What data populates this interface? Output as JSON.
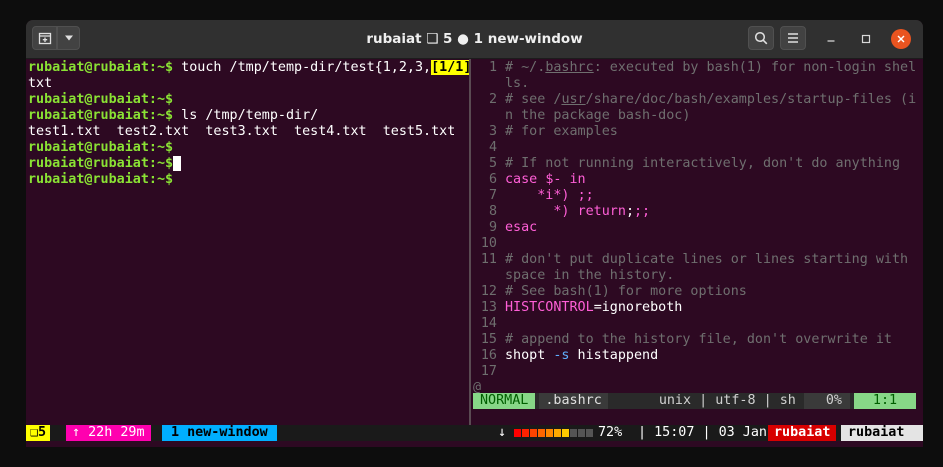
{
  "window": {
    "title": "rubaiat ❑ 5 ● 1 new-window",
    "buttons": [
      "new-tab-icon",
      "dropdown-icon",
      "search-icon",
      "menu-icon",
      "minimize-icon",
      "maximize-icon",
      "close-icon"
    ],
    "accent_close": "#e95420"
  },
  "terminal": {
    "lines": [
      {
        "prompt": "rubaiat@rubaiat:~$",
        "cmd": " touch /tmp/temp-dir/test{1,2,3,",
        "badge": "[1/1]"
      },
      {
        "text": "txt"
      },
      {
        "prompt": "rubaiat@rubaiat:~$",
        "cmd": ""
      },
      {
        "prompt": "rubaiat@rubaiat:~$",
        "cmd": " ls /tmp/temp-dir/"
      },
      {
        "text": "test1.txt  test2.txt  test3.txt  test4.txt  test5.txt"
      },
      {
        "prompt": "rubaiat@rubaiat:~$",
        "cmd": ""
      },
      {
        "prompt": "rubaiat@rubaiat:~$",
        "cmd": " ",
        "cursor": true
      },
      {
        "prompt": "rubaiat@rubaiat:~$",
        "cmd": ""
      }
    ],
    "prompt_color": "#8ae234",
    "badge_color": "#ffff00"
  },
  "vim": {
    "lines": [
      {
        "n": "1",
        "parts": [
          [
            "cm",
            "# ~/."
          ],
          [
            "cm ul",
            "bashrc"
          ],
          [
            "cm",
            ": executed by bash(1) for non-login shel"
          ]
        ]
      },
      {
        "n": "",
        "parts": [
          [
            "cm",
            "ls."
          ]
        ]
      },
      {
        "n": "2",
        "parts": [
          [
            "cm",
            "# see /"
          ],
          [
            "cm ul",
            "usr"
          ],
          [
            "cm",
            "/share/doc/bash/examples/startup-files (i"
          ]
        ]
      },
      {
        "n": "",
        "parts": [
          [
            "cm",
            "n the package bash-doc)"
          ]
        ]
      },
      {
        "n": "3",
        "parts": [
          [
            "cm",
            "# for examples"
          ]
        ]
      },
      {
        "n": "4",
        "parts": []
      },
      {
        "n": "5",
        "parts": [
          [
            "cm",
            "# If not running interactively, don't do anything"
          ]
        ]
      },
      {
        "n": "6",
        "parts": [
          [
            "kw",
            "case"
          ],
          [
            "vt",
            " "
          ],
          [
            "kw",
            "$-"
          ],
          [
            "vt",
            " "
          ],
          [
            "kw",
            "in"
          ]
        ]
      },
      {
        "n": "7",
        "parts": [
          [
            "vt",
            "    "
          ],
          [
            "kw",
            "*i*)"
          ],
          [
            "vt",
            " "
          ],
          [
            "kw",
            ";;"
          ]
        ]
      },
      {
        "n": "8",
        "parts": [
          [
            "vt",
            "      "
          ],
          [
            "kw",
            "*)"
          ],
          [
            "vt",
            " "
          ],
          [
            "kw",
            "return"
          ],
          [
            "vt",
            ";"
          ],
          [
            "kw",
            ";;"
          ]
        ]
      },
      {
        "n": "9",
        "parts": [
          [
            "kw",
            "esac"
          ]
        ]
      },
      {
        "n": "10",
        "parts": []
      },
      {
        "n": "11",
        "parts": [
          [
            "cm",
            "# don't put duplicate lines or lines starting with"
          ]
        ]
      },
      {
        "n": "",
        "parts": [
          [
            "cm",
            "space in the history."
          ]
        ]
      },
      {
        "n": "12",
        "parts": [
          [
            "cm",
            "# See bash(1) for more options"
          ]
        ]
      },
      {
        "n": "13",
        "parts": [
          [
            "kw",
            "HISTCONTROL"
          ],
          [
            "vt",
            "=ignoreboth"
          ]
        ]
      },
      {
        "n": "14",
        "parts": []
      },
      {
        "n": "15",
        "parts": [
          [
            "cm",
            "# append to the history file, don't overwrite it"
          ]
        ]
      },
      {
        "n": "16",
        "parts": [
          [
            "vt",
            "shopt "
          ],
          [
            "op",
            "-s"
          ],
          [
            "vt",
            " histappend"
          ]
        ]
      },
      {
        "n": "17",
        "parts": []
      }
    ],
    "tilde": "@",
    "statusline": {
      "mode": "NORMAL",
      "file": ".bashrc",
      "info": "unix | utf-8 | sh",
      "percent": "0%",
      "position": "1:1"
    }
  },
  "tmux": {
    "session": "❑5",
    "uptime": "↑ 22h 29m",
    "window": "1 new-window",
    "arrow": "↓",
    "battery": "72%",
    "battery_level": 0.72,
    "time": "15:07",
    "date": "03 Jan",
    "host1": "rubaiat",
    "host2": "rubaiat",
    "colors": {
      "session_bg": "#ffff00",
      "uptime_bg": "#ff00af",
      "window_bg": "#00afff",
      "host1_bg": "#d70000",
      "host2_bg": "#e4e4e4"
    }
  }
}
